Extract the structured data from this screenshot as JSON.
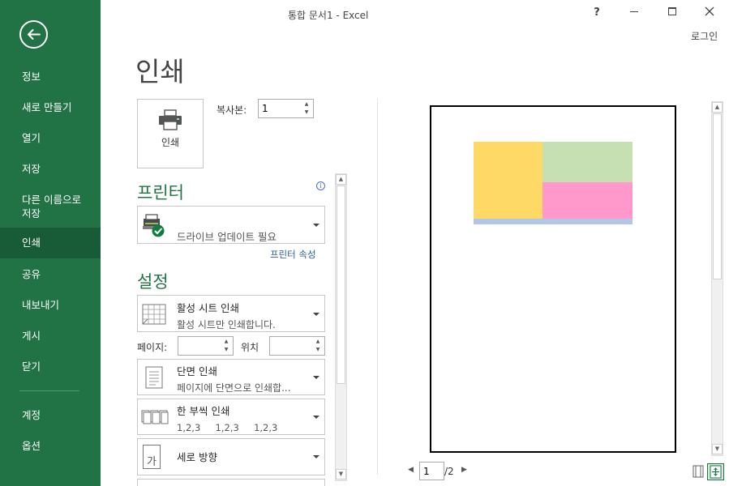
{
  "window": {
    "title": "통합 문서1 - Excel",
    "help": "?",
    "login": "로그인"
  },
  "sidebar": {
    "items": [
      {
        "label": "정보"
      },
      {
        "label": "새로 만들기"
      },
      {
        "label": "열기"
      },
      {
        "label": "저장"
      },
      {
        "label": "다른 이름으로\n저장"
      },
      {
        "label": "인쇄",
        "active": true
      },
      {
        "label": "공유"
      },
      {
        "label": "내보내기"
      },
      {
        "label": "게시"
      },
      {
        "label": "닫기"
      },
      {
        "label": "계정"
      },
      {
        "label": "옵션"
      }
    ]
  },
  "print": {
    "page_title": "인쇄",
    "print_button": "인쇄",
    "copies_label": "복사본:",
    "copies_value": "1"
  },
  "printer": {
    "heading": "프린터",
    "status": "드라이브 업데이트 필요",
    "properties_link": "프린터 속성"
  },
  "settings": {
    "heading": "설정",
    "scope": {
      "main": "활성 시트 인쇄",
      "sub": "활성 시트만 인쇄합니다."
    },
    "pages_label": "페이지:",
    "to_label": "위치",
    "sides": {
      "main": "단면 인쇄",
      "sub": "페이지에 단면으로 인쇄합..."
    },
    "collate": {
      "main": "한 부씩 인쇄",
      "sub": "1,2,3     1,2,3     1,2,3"
    },
    "orientation": {
      "main": "세로 방향",
      "icon_text": "가"
    }
  },
  "preview": {
    "current_page": "1",
    "total_pages": "/2",
    "colors": {
      "yellow": "#ffd966",
      "green": "#c6e0b4",
      "pink": "#ff99cc",
      "blue": "#b4c6e7"
    }
  },
  "colors": {
    "accent": "#217346",
    "accent_dark": "#185c37"
  }
}
